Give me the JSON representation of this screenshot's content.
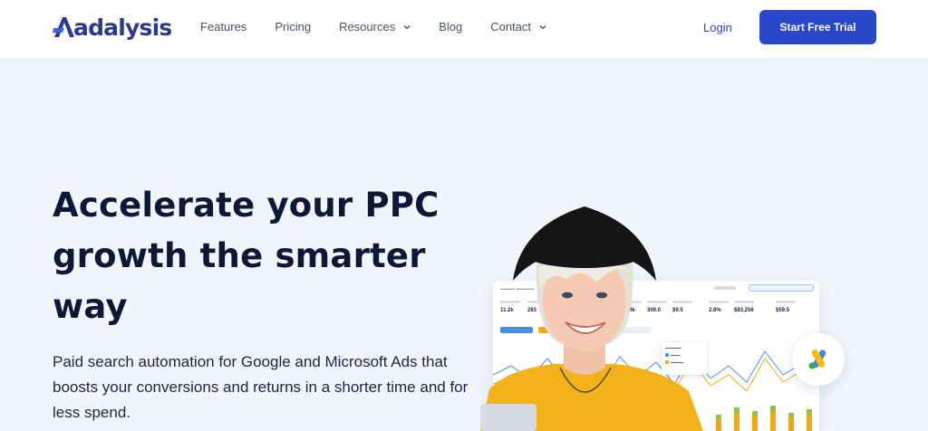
{
  "brand": {
    "name": "adalysis"
  },
  "nav": {
    "items": [
      {
        "label": "Features",
        "has_dropdown": false
      },
      {
        "label": "Pricing",
        "has_dropdown": false
      },
      {
        "label": "Resources",
        "has_dropdown": true
      },
      {
        "label": "Blog",
        "has_dropdown": false
      },
      {
        "label": "Contact",
        "has_dropdown": true
      }
    ],
    "login": "Login",
    "cta": "Start Free Trial"
  },
  "hero": {
    "headline": "Accelerate your PPC growth the smarter way",
    "subtext": "Paid search automation for Google and Microsoft Ads that boosts your conversions and returns in a shorter time and for less spend."
  },
  "dashboard": {
    "metrics": [
      "11.2k",
      "283",
      "23.4k",
      "309.0",
      "$9.5",
      "2.8%",
      "$83,256",
      "$59.5"
    ]
  },
  "icons": [
    "chevron-down-icon",
    "google-ads-icon"
  ],
  "colors": {
    "accent": "#2b47c9",
    "brand": "#2d3a8c",
    "background": "#f1f6fd"
  }
}
